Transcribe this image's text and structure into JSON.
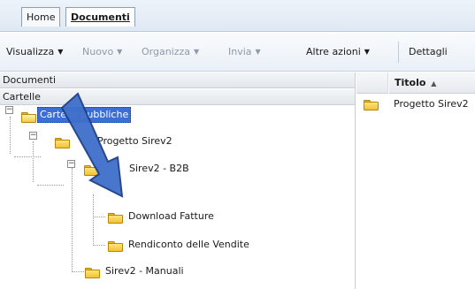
{
  "tabs": [
    {
      "label": "Home"
    },
    {
      "label": "Documenti"
    }
  ],
  "toolbar": {
    "items": [
      {
        "label": "Visualizza",
        "enabled": true,
        "dropdown": true
      },
      {
        "label": "Nuovo",
        "enabled": false,
        "dropdown": true
      },
      {
        "label": "Organizza",
        "enabled": false,
        "dropdown": true
      },
      {
        "label": "Invia",
        "enabled": false,
        "dropdown": true
      },
      {
        "label": "Altre azioni",
        "enabled": true,
        "dropdown": true
      },
      {
        "label": "Dettagli",
        "enabled": true,
        "dropdown": false
      }
    ],
    "caret_glyph": "▼"
  },
  "left_panel": {
    "header": "Documenti",
    "subheader": "Cartelle",
    "tree": [
      {
        "label": "Cartelle pubbliche",
        "selected": true,
        "expanded": true,
        "level": 0,
        "icon": "folder-open-icon"
      },
      {
        "label": "Progetto Sirev2",
        "selected": false,
        "expanded": true,
        "level": 1,
        "icon": "folder-icon"
      },
      {
        "label": "Sirev2 - B2B",
        "selected": false,
        "expanded": true,
        "level": 2,
        "icon": "folder-icon"
      },
      {
        "label": "Download Fatture",
        "selected": false,
        "level": 3,
        "icon": "folder-icon"
      },
      {
        "label": "Rendiconto delle Vendite",
        "selected": false,
        "level": 3,
        "icon": "folder-icon"
      },
      {
        "label": "Sirev2 - Manuali",
        "selected": false,
        "level": 2,
        "icon": "folder-icon"
      }
    ]
  },
  "right_panel": {
    "column_title": "Titolo",
    "sort_glyph": "▲",
    "rows": [
      {
        "title": "Progetto Sirev2",
        "icon": "folder-icon"
      }
    ]
  },
  "annotation": {
    "type": "arrow",
    "color": "#3f6fcb",
    "outline": "#1e3f86"
  }
}
